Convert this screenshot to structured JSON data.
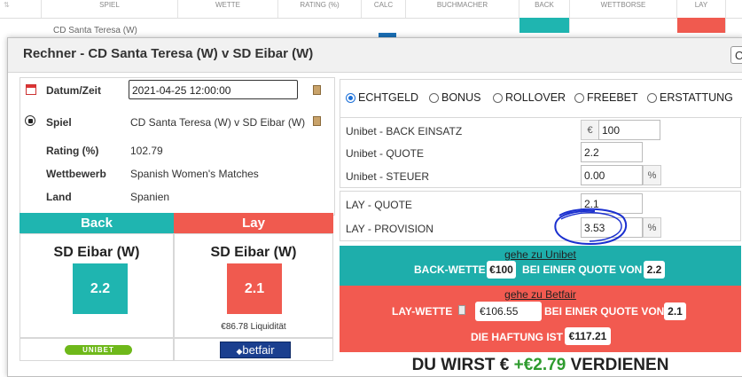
{
  "background_table": {
    "headers": [
      "SPIEL",
      "WETTE",
      "RATING (%)",
      "CALC",
      "BUCHMACHER",
      "BACK",
      "WETTBORSE",
      "LAY"
    ],
    "row_text": "CD Santa Teresa (W)"
  },
  "modal": {
    "title": "Rechner - CD Santa Teresa (W) v SD Eibar (W)",
    "close_label": "C"
  },
  "info": {
    "date_label": "Datum/Zeit",
    "date_value": "2021-04-25 12:00:00",
    "event_label": "Spiel",
    "event_value": "CD Santa Teresa (W) v SD Eibar (W)",
    "rating_label": "Rating (%)",
    "rating_value": "102.79",
    "competition_label": "Wettbewerb",
    "competition_value": "Spanish Women's Matches",
    "country_label": "Land",
    "country_value": "Spanien"
  },
  "back": {
    "header": "Back",
    "selection": "SD Eibar (W)",
    "odds": "2.2",
    "bookmaker_logo_text": "UNIBET"
  },
  "lay": {
    "header": "Lay",
    "selection": "SD Eibar (W)",
    "odds": "2.1",
    "liquidity": "€86.78 Liquidität",
    "exchange_logo_text": "betfair"
  },
  "mode_options": [
    {
      "label": "ECHTGELD",
      "selected": true
    },
    {
      "label": "BONUS",
      "selected": false
    },
    {
      "label": "ROLLOVER",
      "selected": false
    },
    {
      "label": "FREEBET",
      "selected": false
    },
    {
      "label": "ERSTATTUNG",
      "selected": false
    }
  ],
  "back_inputs": {
    "stake_label": "Unibet - BACK EINSATZ",
    "stake_prefix": "€",
    "stake_value": "100",
    "odds_label": "Unibet - QUOTE",
    "odds_value": "2.2",
    "tax_label": "Unibet - STEUER",
    "tax_value": "0.00",
    "tax_suffix": "%"
  },
  "lay_inputs": {
    "odds_label": "LAY - QUOTE",
    "odds_value": "2.1",
    "commission_label": "LAY - PROVISION",
    "commission_value": "3.53",
    "commission_suffix": "%"
  },
  "back_result": {
    "link": "gehe zu Unibet",
    "text_pre": "BACK-WETTE",
    "stake": "€100",
    "text_mid": "BEI EINER QUOTE VON",
    "odds": "2.2"
  },
  "lay_result": {
    "link": "gehe zu Betfair",
    "text_pre": "LAY-WETTE",
    "stake": "€106.55",
    "text_mid": "BEI EINER QUOTE VON",
    "odds": "2.1",
    "liability_text": "DIE HAFTUNG IST",
    "liability": "€117.21"
  },
  "profit": {
    "pre": "DU WIRST €",
    "amount": "+€2.79",
    "post": "VERDIENEN"
  },
  "colors": {
    "back": "#1fb5b0",
    "lay": "#f05a4f",
    "back_band": "#1eaeab",
    "lay_band": "#f25a50",
    "profit_green": "#2e9b2e",
    "annotation": "#1a2fcf"
  }
}
